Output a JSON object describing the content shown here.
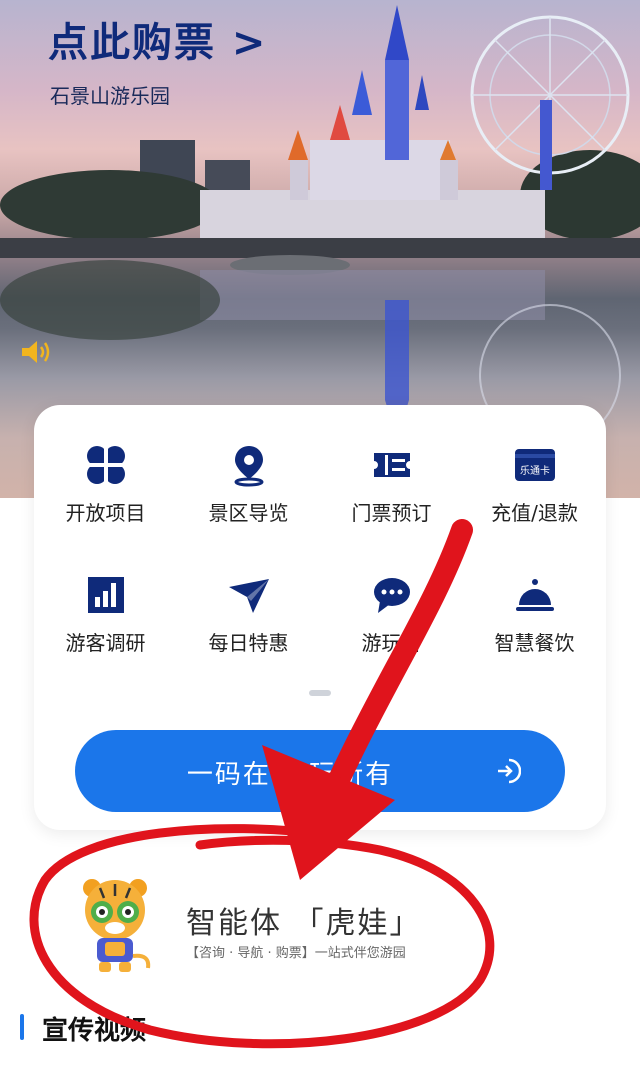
{
  "banner": {
    "title": "点此购票 >",
    "subtitle": "石景山游乐园"
  },
  "menu": {
    "items": [
      {
        "label": "开放项目",
        "icon": "four-petal-icon"
      },
      {
        "label": "景区导览",
        "icon": "location-pin-icon"
      },
      {
        "label": "门票预订",
        "icon": "ticket-icon"
      },
      {
        "label": "充值/退款",
        "icon": "card-icon",
        "icon_text": "乐通卡"
      },
      {
        "label": "游客调研",
        "icon": "bar-chart-icon"
      },
      {
        "label": "每日特惠",
        "icon": "paper-plane-icon"
      },
      {
        "label": "游玩咨",
        "icon": "chat-bubble-icon"
      },
      {
        "label": "智慧餐饮",
        "icon": "cloche-icon"
      }
    ],
    "cta_label": "一码在手 玩所有"
  },
  "agent": {
    "title": "智能体 「虎娃」",
    "subtitle": "【咨询 · 导航 · 购票】一站式伴您游园"
  },
  "section": {
    "title": "宣传视频"
  },
  "colors": {
    "brand_navy": "#0f2a7a",
    "accent_blue": "#1b76ea",
    "annotation_red": "#e0141c"
  }
}
